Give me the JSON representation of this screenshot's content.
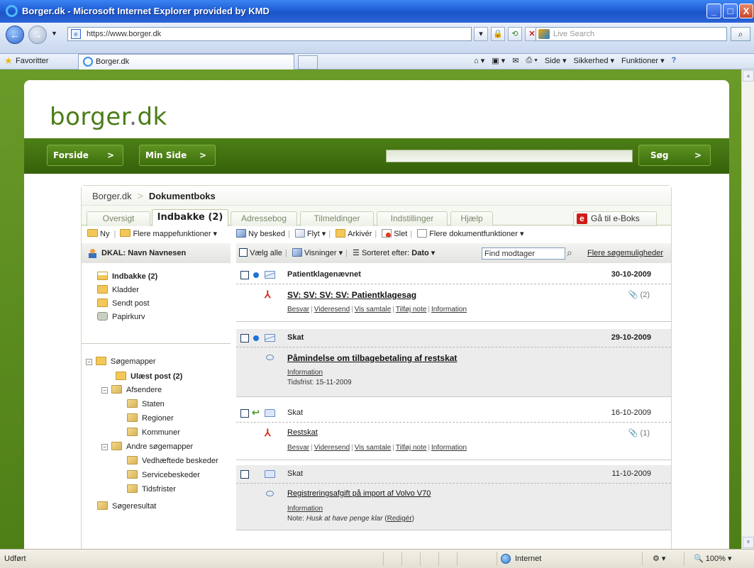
{
  "window": {
    "title": "Borger.dk - Microsoft Internet Explorer provided by KMD",
    "min_label": "_",
    "max_label": "□",
    "close_label": "X"
  },
  "browser": {
    "back_label": "←",
    "forward_label": "→",
    "address": "https://www.borger.dk",
    "search_placeholder": "Live Search",
    "favorites_label": "Favoritter",
    "tab_title": "Borger.dk",
    "commands": {
      "page": "Side",
      "safety": "Sikkerhed",
      "tools": "Funktioner"
    }
  },
  "site": {
    "logo_main": "borger",
    "logo_dot": ".",
    "logo_tld": "dk",
    "nav": {
      "home": "Forside",
      "mypage": "Min Side",
      "search_button": "Søg",
      "chevron": ">"
    }
  },
  "breadcrumb": {
    "root": "Borger.dk",
    "current": "Dokumentboks",
    "separator": ">"
  },
  "tabs": {
    "overview": "Oversigt",
    "inbox": "Indbakke (2)",
    "addressbook": "Adressebog",
    "signups": "Tilmeldinger",
    "settings": "Indstillinger",
    "help": "Hjælp",
    "eboks": "Gå til e-Boks",
    "eboks_letter": "e"
  },
  "left_toolbar": {
    "new": "Ny",
    "more_folder": "Flere mappefunktioner"
  },
  "user": {
    "name": "DKAL: Navn Navnesen"
  },
  "folders": {
    "inbox": "Indbakke (2)",
    "drafts": "Kladder",
    "sent": "Sendt post",
    "trash": "Papirkurv"
  },
  "search_folders": {
    "root": "Søgemapper",
    "unread": "Ulæst post (2)",
    "senders": "Afsendere",
    "state": "Staten",
    "regions": "Regioner",
    "municipalities": "Kommuner",
    "other": "Andre søgemapper",
    "attachments": "Vedhæftede beskeder",
    "service": "Servicebeskeder",
    "deadlines": "Tidsfrister",
    "results": "Søgeresultat",
    "toggle_minus": "−"
  },
  "main_toolbar": {
    "new_message": "Ny besked",
    "move": "Flyt",
    "archive": "Arkivér",
    "delete": "Slet",
    "more_doc": "Flere dokumentfunktioner"
  },
  "list_toolbar": {
    "select_all": "Vælg alle",
    "views": "Visninger",
    "sorted_label": "Sorteret efter:",
    "sorted_value": "Dato",
    "find_value": "Find modtager",
    "more_search": "Flere søgemuligheder"
  },
  "actions": {
    "reply": "Besvar",
    "forward": "Videresend",
    "thread": "Vis samtale",
    "note": "Tilføj note",
    "info": "Information",
    "edit": "Redigér"
  },
  "messages": [
    {
      "sender": "Patientklagenævnet",
      "date": "30-10-2009",
      "subject": "SV: SV: SV: SV: Patientklagesag",
      "attachments": "(2)"
    },
    {
      "sender": "Skat",
      "date": "29-10-2009",
      "subject": "Påmindelse om tilbagebetaling af restskat",
      "deadline": "Tidsfrist: 15-11-2009"
    },
    {
      "sender": "Skat",
      "date": "16-10-2009",
      "subject": "Restskat",
      "attachments": "(1)"
    },
    {
      "sender": "Skat",
      "date": "11-10-2009",
      "subject": "Registreringsafgift på import af Volvo V70",
      "note_label": "Note:",
      "note_text": "Husk at have penge klar"
    }
  ],
  "status": {
    "left": "Udført",
    "zone": "Internet",
    "zoom": "100%"
  }
}
